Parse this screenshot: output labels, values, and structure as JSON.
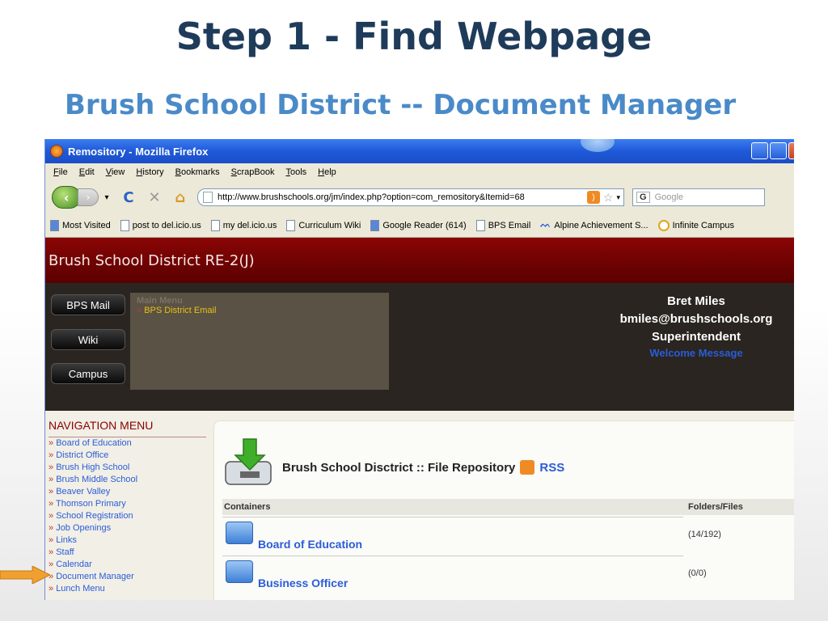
{
  "slide": {
    "title": "Step 1 - Find Webpage",
    "subtitle": "Brush School District -- Document Manager"
  },
  "browser": {
    "window_title": "Remository - Mozilla Firefox",
    "menu": [
      "File",
      "Edit",
      "View",
      "History",
      "Bookmarks",
      "ScrapBook",
      "Tools",
      "Help"
    ],
    "url": "http://www.brushschools.org/jm/index.php?option=com_remository&Itemid=68",
    "search_placeholder": "Google",
    "bookmarks": [
      "Most Visited",
      "post to del.icio.us",
      "my del.icio.us",
      "Curriculum Wiki",
      "Google Reader (614)",
      "BPS Email",
      "Alpine Achievement S...",
      "Infinite Campus"
    ]
  },
  "site": {
    "header": "Brush School District RE-2(J)",
    "side_buttons": [
      "BPS Mail",
      "Wiki",
      "Campus"
    ],
    "main_menu_heading": "Main Menu",
    "main_menu_link": "BPS District Email",
    "user": {
      "name": "Bret Miles",
      "email": "bmiles@brushschools.org",
      "role": "Superintendent",
      "welcome": "Welcome Message"
    },
    "nav_menu_title": "NAVIGATION MENU",
    "nav_items": [
      "Board of Education",
      "District Office",
      "Brush High School",
      "Brush Middle School",
      "Beaver Valley",
      "Thomson Primary",
      "School Registration",
      "Job Openings",
      "Links",
      "Staff",
      "Calendar",
      "Document Manager",
      "Lunch Menu"
    ],
    "repository": {
      "title": "Brush School Disctrict :: File Repository",
      "rss": "RSS",
      "col_containers": "Containers",
      "col_counts": "Folders/Files",
      "rows": [
        {
          "name": "Board of Education",
          "count": "(14/192)"
        },
        {
          "name": "Business Officer",
          "count": "(0/0)"
        }
      ]
    }
  },
  "colors": {
    "slide_title": "#1f3b5a",
    "slide_subtitle": "#4a8ac8",
    "site_header": "#7a0000",
    "link": "#2b5cd8",
    "pointer_arrow": "#f0a030"
  }
}
